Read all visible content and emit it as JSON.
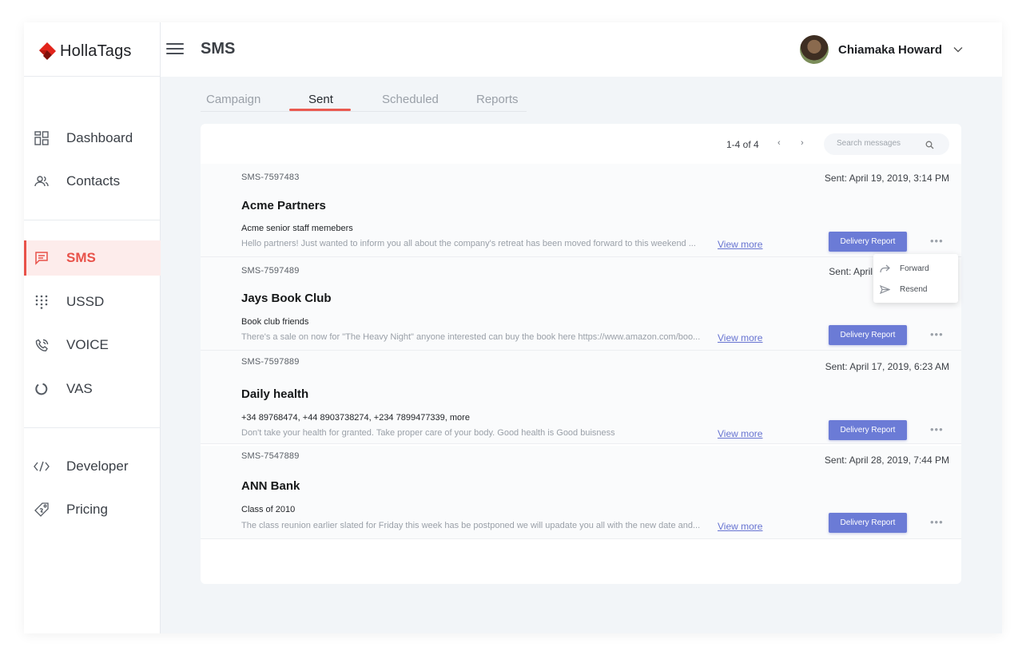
{
  "app": {
    "name": "HollaTags",
    "page_title": "SMS"
  },
  "user": {
    "name": "Chiamaka Howard"
  },
  "sidebar": {
    "items": [
      {
        "label": "Dashboard",
        "icon": "dashboard-icon"
      },
      {
        "label": "Contacts",
        "icon": "contacts-icon"
      },
      {
        "label": "SMS",
        "icon": "sms-icon",
        "active": true
      },
      {
        "label": "USSD",
        "icon": "ussd-dialpad-icon"
      },
      {
        "label": "VOICE",
        "icon": "phone-icon"
      },
      {
        "label": "VAS",
        "icon": "vas-ring-icon"
      },
      {
        "label": "Developer",
        "icon": "code-icon"
      },
      {
        "label": "Pricing",
        "icon": "price-tag-icon"
      }
    ]
  },
  "tabs": [
    {
      "label": "Campaign"
    },
    {
      "label": "Sent",
      "active": true
    },
    {
      "label": "Scheduled"
    },
    {
      "label": "Reports"
    }
  ],
  "toolbar": {
    "pagination": "1-4 of 4",
    "prev": "‹",
    "next": "›",
    "search_placeholder": "Search messages"
  },
  "messages": [
    {
      "id": "SMS-7597483",
      "sent": "Sent: April 19, 2019, 3:14 PM",
      "title": "Acme Partners",
      "recipients": "Acme senior staff memebers",
      "preview": "Hello partners! Just wanted to inform you all about the company's retreat has been moved forward to this weekend ...",
      "view_more": "View more",
      "button": "Delivery Report",
      "more": "•••"
    },
    {
      "id": "SMS-7597489",
      "sent": "Sent: April",
      "title": "Jays Book Club",
      "recipients": "Book club friends",
      "preview": "There's a sale on now for \"The Heavy Night\" anyone interested can buy the book here https://www.amazon.com/boo...",
      "view_more": "View more",
      "button": "Delivery Report",
      "more": "•••"
    },
    {
      "id": "SMS-7597889",
      "sent": "Sent: April 17, 2019, 6:23 AM",
      "title": "Daily health",
      "recipients": "+34 89768474, +44 8903738274, +234 7899477339, more",
      "preview": "Don't take your health for granted. Take proper care of your body. Good health is Good buisness",
      "view_more": "View more",
      "button": "Delivery Report",
      "more": "•••"
    },
    {
      "id": "SMS-7547889",
      "sent": "Sent: April 28, 2019, 7:44 PM",
      "title": "ANN Bank",
      "recipients": "Class of 2010",
      "preview": "The class reunion earlier slated for Friday this week has be postponed we will upadate you all with the new date and...",
      "view_more": "View more",
      "button": "Delivery Report",
      "more": "•••"
    }
  ],
  "context_menu": {
    "items": [
      {
        "label": "Forward",
        "icon": "forward-icon"
      },
      {
        "label": "Resend",
        "icon": "send-icon"
      }
    ]
  },
  "colors": {
    "accent": "#e8524a",
    "button": "#6b7bd6",
    "link": "#6673d1"
  }
}
